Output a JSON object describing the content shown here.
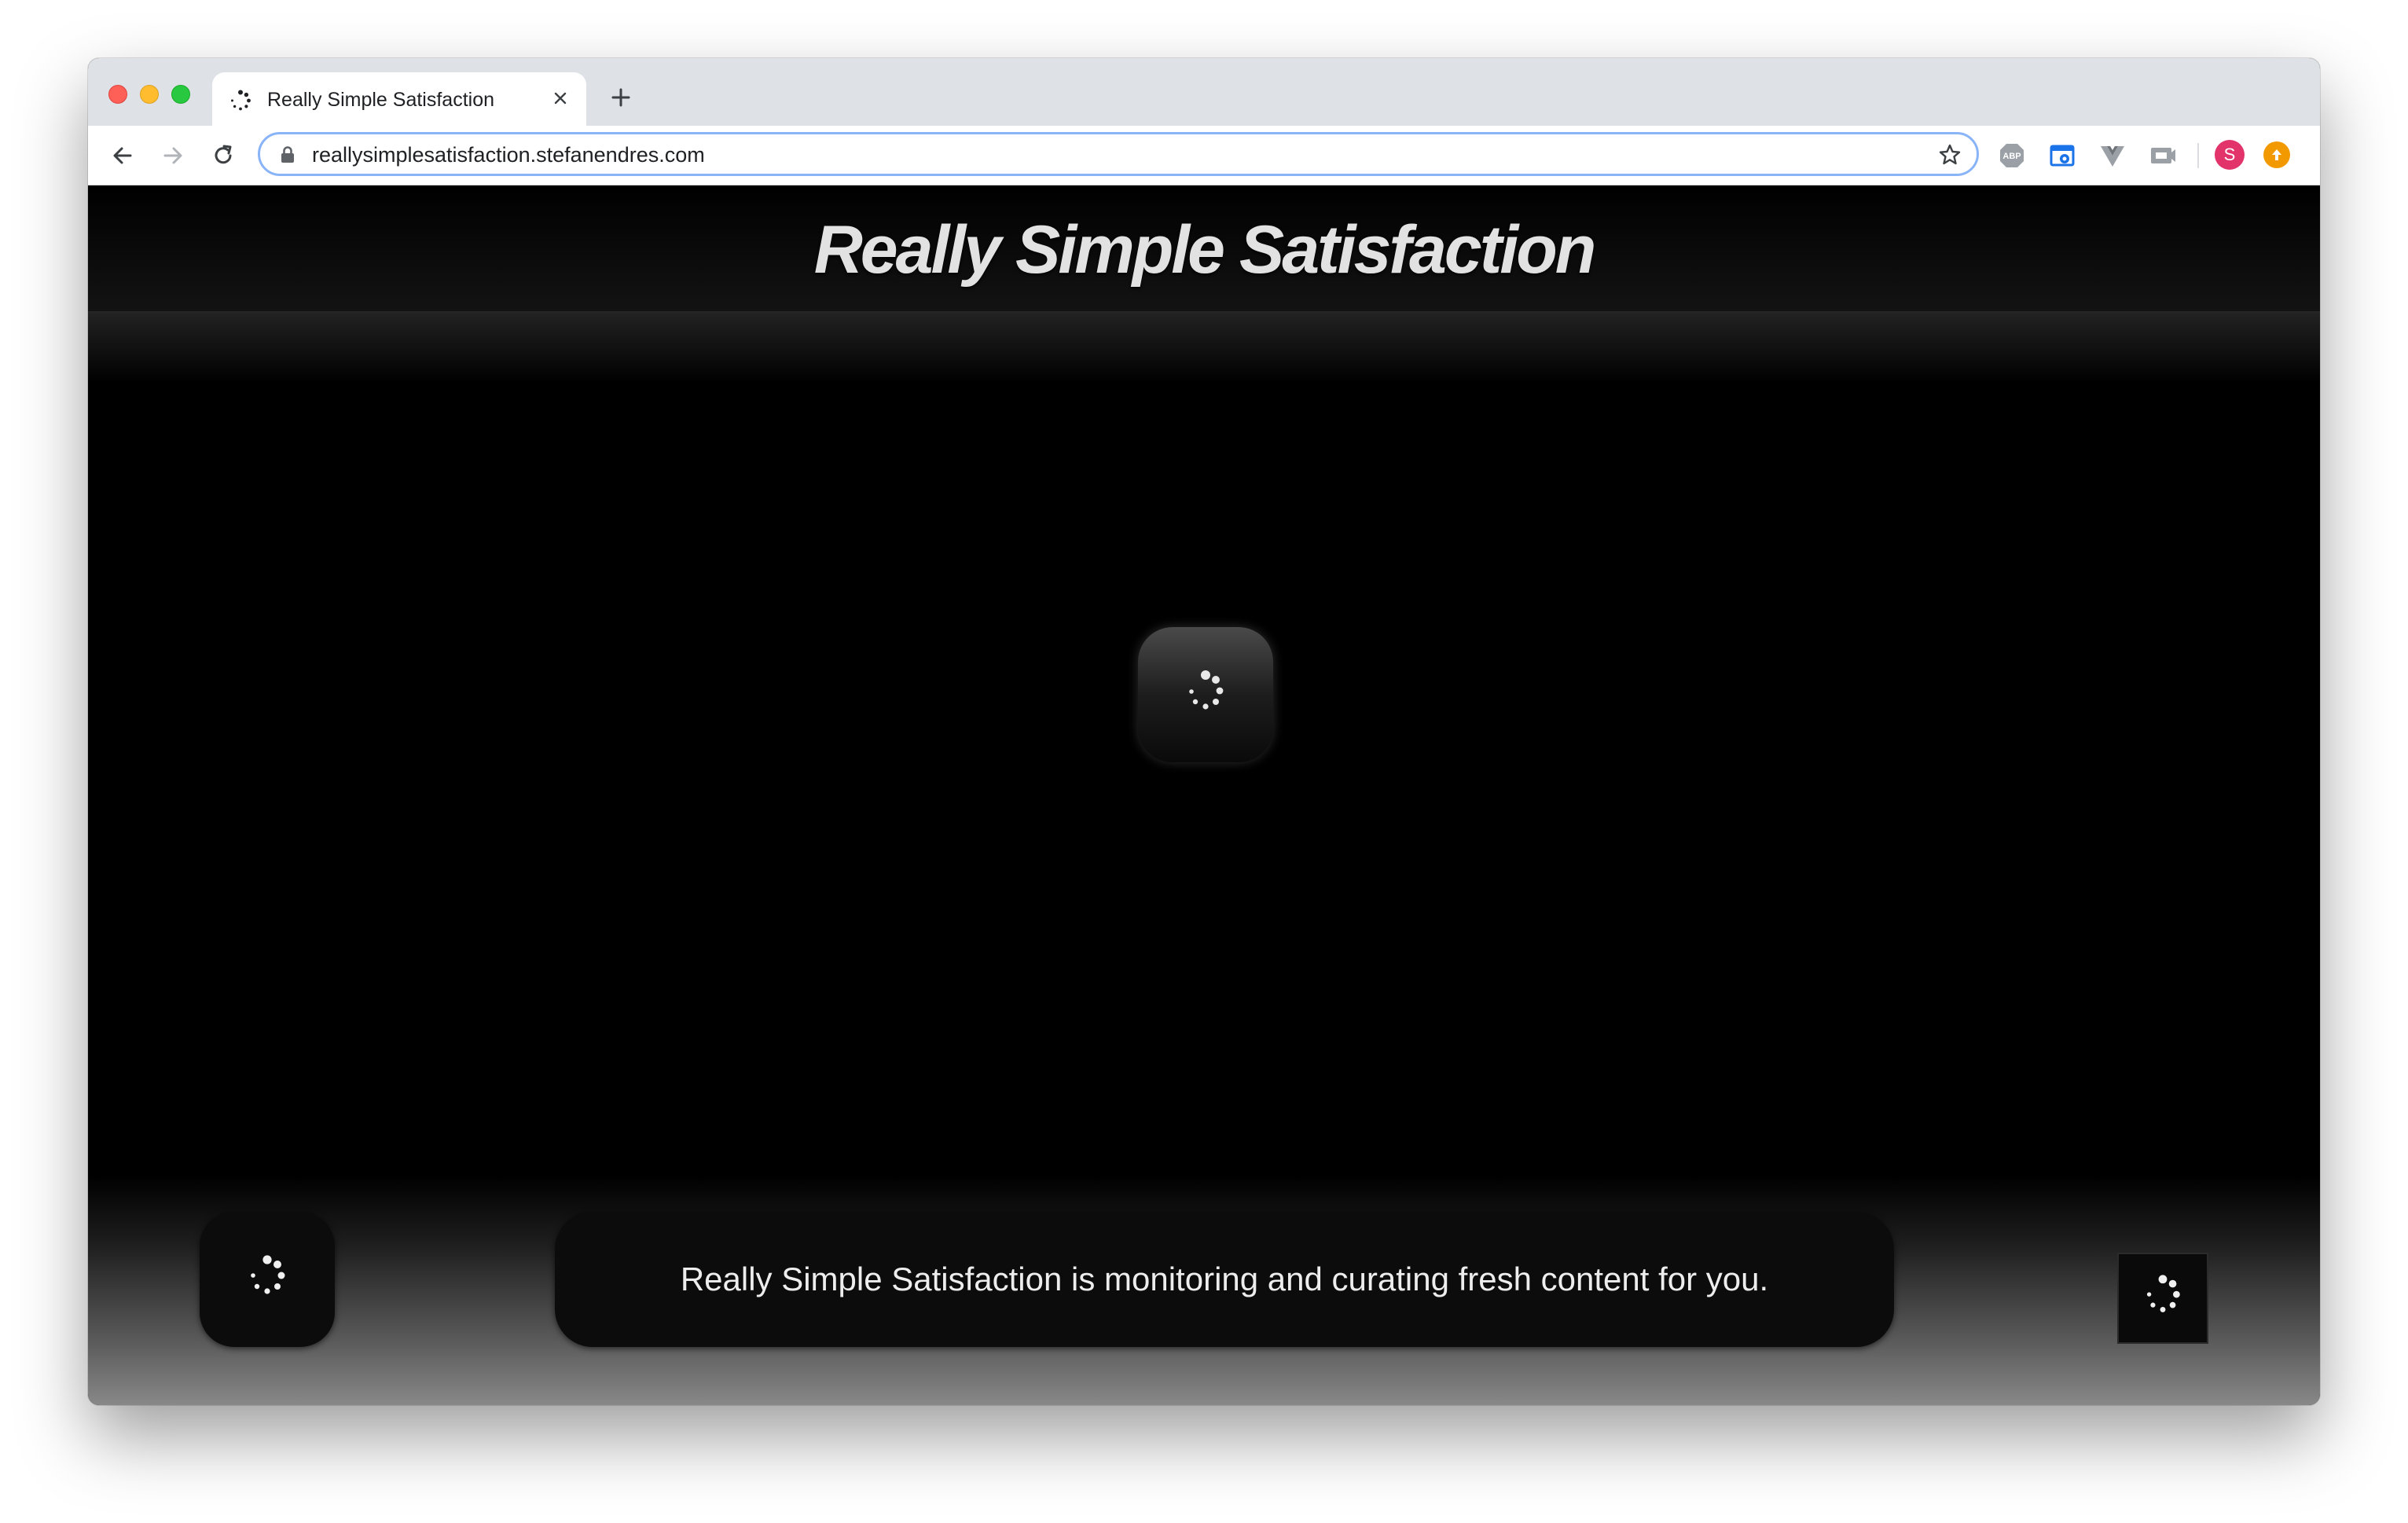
{
  "browser": {
    "tab_title": "Really Simple Satisfaction",
    "url": "reallysimplesatisfaction.stefanendres.com",
    "profile_initial": "S",
    "extensions": [
      "abp-icon",
      "screenshot-extension-icon",
      "vue-devtools-icon",
      "cast-extension-icon"
    ]
  },
  "site": {
    "title": "Really Simple Satisfaction",
    "status_message": "Really Simple Satisfaction is monitoring and curating fresh content for you."
  }
}
